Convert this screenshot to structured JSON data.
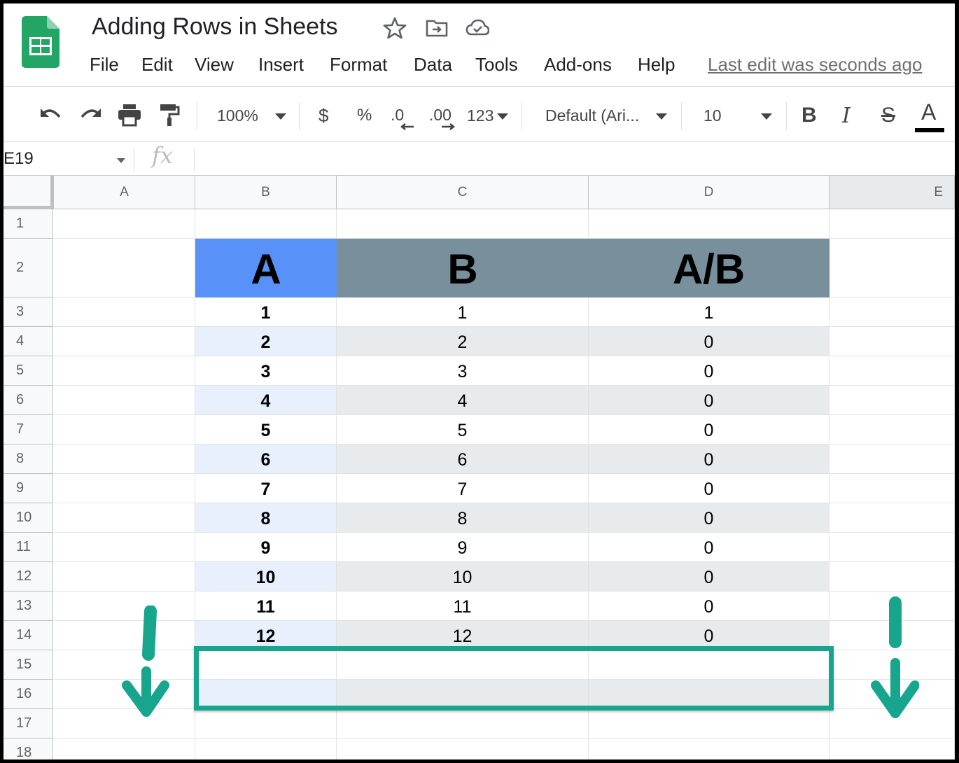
{
  "window": {
    "title": "Adding Rows in Sheets",
    "last_edit": "Last edit was seconds ago"
  },
  "title_icons": [
    "star-icon",
    "move-to-folder-icon",
    "cloud-status-icon"
  ],
  "menu": [
    "File",
    "Edit",
    "View",
    "Insert",
    "Format",
    "Data",
    "Tools",
    "Add-ons",
    "Help"
  ],
  "toolbar": {
    "zoom": "100%",
    "currency": "$",
    "percent": "%",
    "decrease_decimal": ".0",
    "increase_decimal": ".00",
    "more_formats": "123",
    "font": "Default (Ari...",
    "font_size": "10",
    "bold": "B",
    "italic": "I",
    "strike": "S",
    "text_color": "A"
  },
  "formula_bar": {
    "name_box": "E19",
    "fx": "fx"
  },
  "grid": {
    "columns": [
      "A",
      "B",
      "C",
      "D",
      "E"
    ],
    "rows": [
      "1",
      "2",
      "3",
      "4",
      "5",
      "6",
      "7",
      "8",
      "9",
      "10",
      "11",
      "12",
      "13",
      "14",
      "15",
      "16",
      "17",
      "18"
    ],
    "header_labels": [
      "A",
      "B",
      "A/B"
    ],
    "data": [
      [
        "1",
        "1",
        "1"
      ],
      [
        "2",
        "2",
        "0"
      ],
      [
        "3",
        "3",
        "0"
      ],
      [
        "4",
        "4",
        "0"
      ],
      [
        "5",
        "5",
        "0"
      ],
      [
        "6",
        "6",
        "0"
      ],
      [
        "7",
        "7",
        "0"
      ],
      [
        "8",
        "8",
        "0"
      ],
      [
        "9",
        "9",
        "0"
      ],
      [
        "10",
        "10",
        "0"
      ],
      [
        "11",
        "11",
        "0"
      ],
      [
        "12",
        "12",
        "0"
      ]
    ]
  },
  "colors": {
    "header_a": "#5891f8",
    "header_bc": "#78909c",
    "band_light_blue": "#e8effd",
    "band_gray": "#e8ebee",
    "annotation": "#17a58e"
  }
}
